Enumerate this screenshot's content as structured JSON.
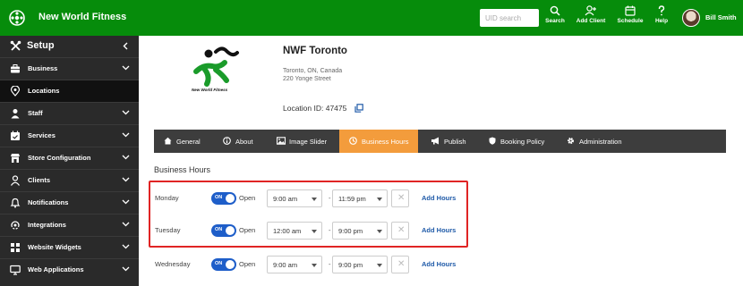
{
  "header": {
    "app_title": "New World Fitness",
    "search_placeholder": "UID search",
    "buttons": [
      {
        "label": "Search",
        "icon": "search-icon"
      },
      {
        "label": "Add Client",
        "icon": "add-user-icon"
      },
      {
        "label": "Schedule",
        "icon": "calendar-icon"
      },
      {
        "label": "Help",
        "icon": "question-icon"
      }
    ],
    "user_name": "Bill Smith",
    "bg_color": "#068c0b"
  },
  "sidebar": {
    "title": "Setup",
    "items": [
      {
        "label": "Business",
        "icon": "briefcase-icon",
        "expandable": true
      },
      {
        "label": "Locations",
        "icon": "location-pin-icon",
        "expandable": false,
        "active": true
      },
      {
        "label": "Staff",
        "icon": "staff-icon",
        "expandable": true
      },
      {
        "label": "Services",
        "icon": "services-icon",
        "expandable": true
      },
      {
        "label": "Store Configuration",
        "icon": "store-icon",
        "expandable": true
      },
      {
        "label": "Clients",
        "icon": "user-icon",
        "expandable": true
      },
      {
        "label": "Notifications",
        "icon": "bell-icon",
        "expandable": true
      },
      {
        "label": "Integrations",
        "icon": "integrations-icon",
        "expandable": true
      },
      {
        "label": "Website Widgets",
        "icon": "widgets-icon",
        "expandable": true
      },
      {
        "label": "Web Applications",
        "icon": "monitor-icon",
        "expandable": true
      }
    ]
  },
  "location": {
    "name": "NWF Toronto",
    "city": "Toronto, ON, Canada",
    "street": "220 Yonge Street",
    "id_label": "Location ID: 47475",
    "logo_caption": "New World Fitness"
  },
  "tabs": [
    {
      "label": "General",
      "icon": "home-icon"
    },
    {
      "label": "About",
      "icon": "info-icon"
    },
    {
      "label": "Image Slider",
      "icon": "image-icon"
    },
    {
      "label": "Business Hours",
      "icon": "clock-icon",
      "active": true
    },
    {
      "label": "Publish",
      "icon": "megaphone-icon"
    },
    {
      "label": "Booking Policy",
      "icon": "shield-icon"
    },
    {
      "label": "Administration",
      "icon": "gear-icon"
    }
  ],
  "business_hours": {
    "title": "Business Hours",
    "toggle_on": "ON",
    "open_label": "Open",
    "separator": "-",
    "add_hours_label": "Add Hours",
    "rows": [
      {
        "day": "Monday",
        "open": "9:00 am",
        "close": "11:59 pm"
      },
      {
        "day": "Tuesday",
        "open": "12:00 am",
        "close": "9:00 pm"
      },
      {
        "day": "Wednesday",
        "open": "9:00 am",
        "close": "9:00 pm"
      }
    ]
  },
  "colors": {
    "accent_tab": "#f39c3c",
    "toggle": "#1e5ec9",
    "link": "#1f5aa8",
    "highlight_box": "#e02424"
  }
}
